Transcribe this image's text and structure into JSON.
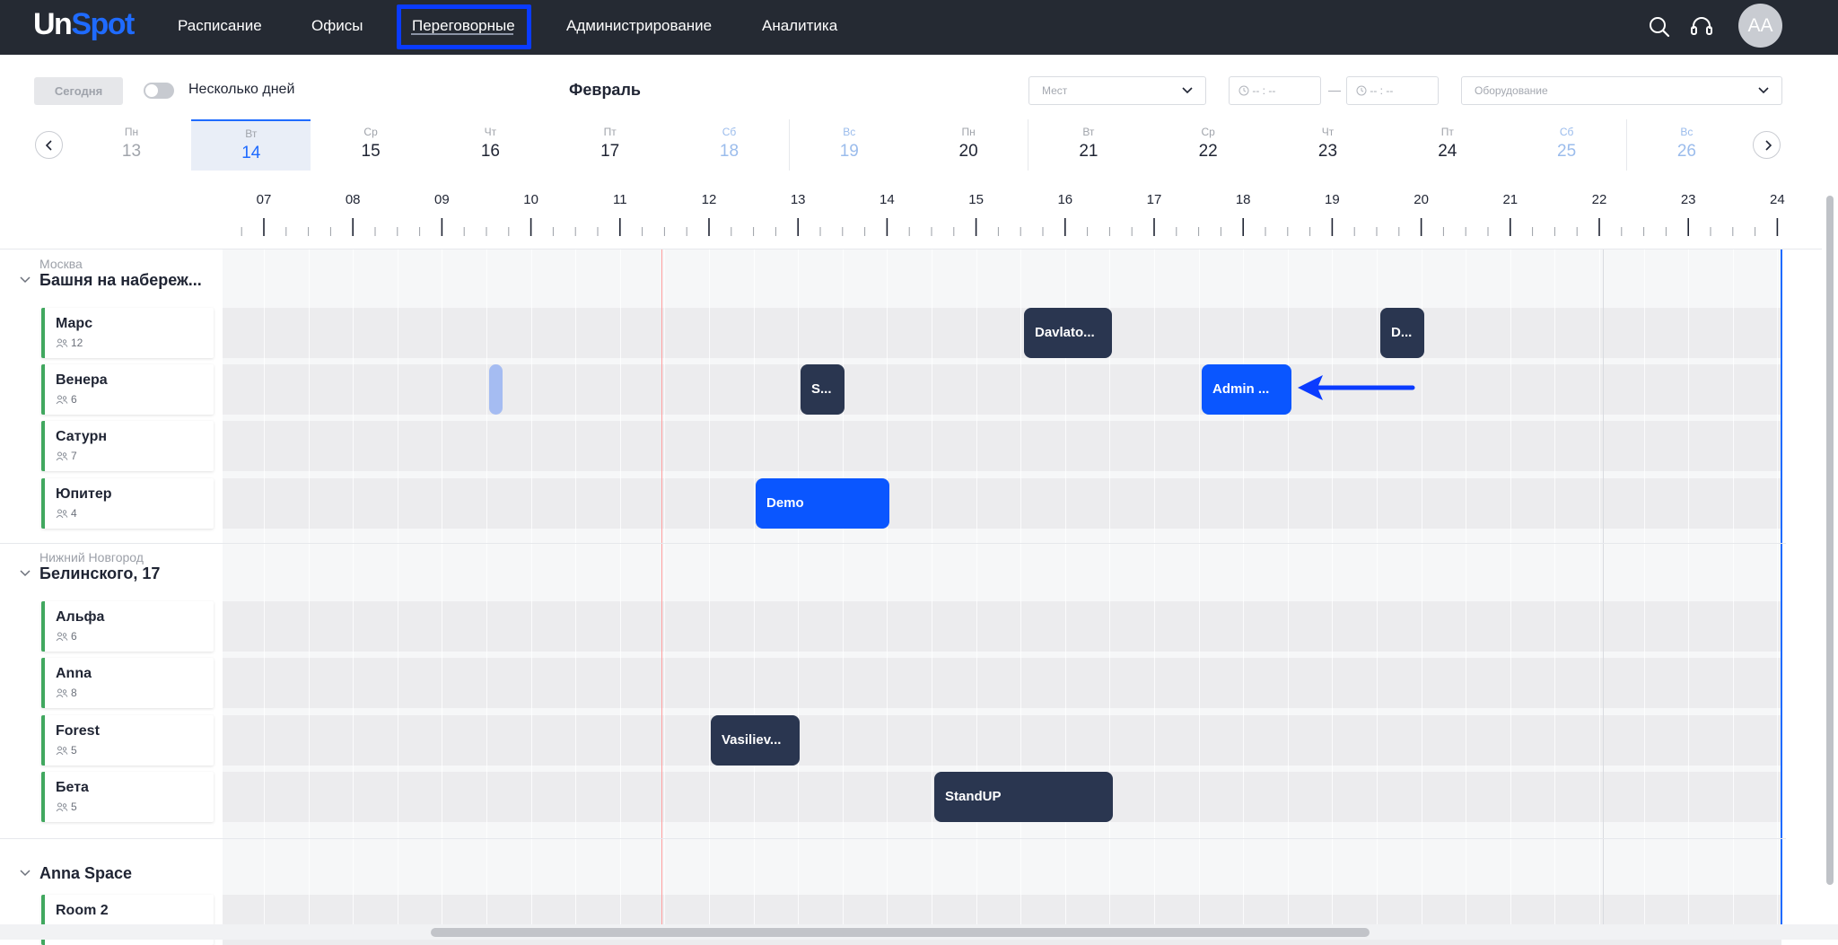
{
  "brand": {
    "part1": "Un",
    "part2": "Spot",
    "accent": "#1f6bff"
  },
  "nav": {
    "items": [
      {
        "id": "schedule",
        "label": "Расписание"
      },
      {
        "id": "offices",
        "label": "Офисы"
      },
      {
        "id": "meeting-rooms",
        "label": "Переговорные",
        "active": true
      },
      {
        "id": "admin",
        "label": "Администрирование"
      },
      {
        "id": "analytics",
        "label": "Аналитика"
      }
    ],
    "icons": [
      "search-icon",
      "support-headset-icon"
    ],
    "avatar_initials": "AA"
  },
  "toolbar": {
    "today_label": "Сегодня",
    "multi_day_label": "Несколько дней",
    "multi_day_enabled": false,
    "month": "Февраль",
    "seats_placeholder": "Мест",
    "time_from_placeholder": "-- : --",
    "time_to_placeholder": "-- : --",
    "time_separator": "—",
    "equipment_placeholder": "Оборудование"
  },
  "days": [
    {
      "dow": "Пн",
      "num": "13",
      "state": "past"
    },
    {
      "dow": "Вт",
      "num": "14",
      "state": "selected"
    },
    {
      "dow": "Ср",
      "num": "15",
      "state": "normal"
    },
    {
      "dow": "Чт",
      "num": "16",
      "state": "normal"
    },
    {
      "dow": "Пт",
      "num": "17",
      "state": "normal"
    },
    {
      "dow": "Сб",
      "num": "18",
      "state": "weekend"
    },
    {
      "dow": "Вс",
      "num": "19",
      "state": "weekend"
    },
    {
      "dow": "Пн",
      "num": "20",
      "state": "normal"
    },
    {
      "dow": "Вт",
      "num": "21",
      "state": "normal"
    },
    {
      "dow": "Ср",
      "num": "22",
      "state": "normal"
    },
    {
      "dow": "Чт",
      "num": "23",
      "state": "normal"
    },
    {
      "dow": "Пт",
      "num": "24",
      "state": "normal"
    },
    {
      "dow": "Сб",
      "num": "25",
      "state": "weekend"
    },
    {
      "dow": "Вс",
      "num": "26",
      "state": "weekend"
    }
  ],
  "hours": [
    "07",
    "08",
    "09",
    "10",
    "11",
    "12",
    "13",
    "14",
    "15",
    "16",
    "17",
    "18",
    "19",
    "20",
    "21",
    "22",
    "23",
    "24"
  ],
  "groups": [
    {
      "city": "Москва",
      "name": "Башня на набереж...",
      "rooms": [
        {
          "name": "Марс",
          "capacity": "12"
        },
        {
          "name": "Венера",
          "capacity": "6"
        },
        {
          "name": "Сатурн",
          "capacity": "7"
        },
        {
          "name": "Юпитер",
          "capacity": "4"
        }
      ]
    },
    {
      "city": "Нижний Новгород",
      "name": "Белинского, 17",
      "rooms": [
        {
          "name": "Альфа",
          "capacity": "6"
        },
        {
          "name": "Anna",
          "capacity": "8"
        },
        {
          "name": "Forest",
          "capacity": "5"
        },
        {
          "name": "Бета",
          "capacity": "5"
        }
      ]
    },
    {
      "city": "",
      "name": "Anna Space",
      "rooms": [
        {
          "name": "Room 2",
          "capacity": ""
        }
      ]
    }
  ],
  "bookings": [
    {
      "room": "Марс",
      "title": "Davlato...",
      "style": "dark"
    },
    {
      "room": "Марс",
      "title": "D...",
      "style": "dark"
    },
    {
      "room": "Венера",
      "title": "",
      "style": "ghost"
    },
    {
      "room": "Венера",
      "title": "S...",
      "style": "dark"
    },
    {
      "room": "Венера",
      "title": "Admin ...",
      "style": "blue"
    },
    {
      "room": "Юпитер",
      "title": "Demo",
      "style": "blue"
    },
    {
      "room": "Forest",
      "title": "Vasiliev...",
      "style": "dark"
    },
    {
      "room": "Бета",
      "title": "StandUP",
      "style": "dark"
    }
  ],
  "colors": {
    "nav_bg": "#252a33",
    "booking_dark": "#2a3650",
    "booking_blue": "#0a56ff",
    "room_marker": "#41a85f",
    "now_line": "#ff9f9f",
    "highlight_box": "#0a3bff"
  }
}
